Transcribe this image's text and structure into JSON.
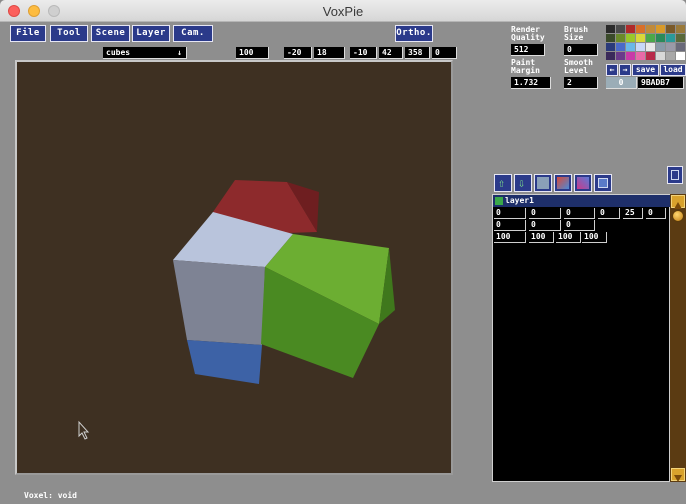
{
  "window": {
    "title": "VoxPie"
  },
  "menu": {
    "file": "File",
    "tool": "Tool",
    "scene": "Scene",
    "layer": "Layer",
    "cam": "Cam.",
    "ortho": "Ortho."
  },
  "toolbar": {
    "shape_select": "cubes",
    "shape_arrow": "↓",
    "fields": [
      "100",
      "-20",
      "18",
      "-10",
      "42",
      "358",
      "0"
    ]
  },
  "settings": {
    "render_quality_label": "Render\nQuality",
    "render_quality_value": "512",
    "brush_size_label": "Brush\nSize",
    "brush_size_value": "0",
    "paint_margin_label": "Paint\nMargin",
    "paint_margin_value": "1.732",
    "smooth_level_label": "Smooth\nLevel",
    "smooth_level_value": "2",
    "prev_arrow": "←",
    "next_arrow": "→",
    "save_label": "save",
    "load_label": "load",
    "color_index": "0",
    "color_hex": "9BADB7"
  },
  "palette": {
    "colors": [
      "#2a2a2a",
      "#4a4a4a",
      "#b02a2a",
      "#d8702a",
      "#c08a3a",
      "#d89a2a",
      "#7a5a2a",
      "#9a7a3a",
      "#3a4a2a",
      "#6a8a2a",
      "#9ac82a",
      "#d8d83a",
      "#4aa84a",
      "#2a8a5a",
      "#2a9a9a",
      "#5a6a3a",
      "#2a3a7a",
      "#4a6ac8",
      "#6ab8e8",
      "#c8d8f8",
      "#e8e8e8",
      "#8a9aa8",
      "#9a9aa8",
      "#6a6a7a",
      "#3a2a5a",
      "#6a3a8a",
      "#c83aa8",
      "#e86aa8",
      "#b82a4a",
      "#d8d8d8",
      "#a8a8a8",
      "#ffffff"
    ]
  },
  "layers": {
    "rows": [
      {
        "name": "layer1"
      }
    ],
    "transform_row1": [
      "0",
      "0",
      "0",
      "0",
      "25",
      "0"
    ],
    "transform_row2": [
      "0",
      "0",
      "0"
    ],
    "transform_row3": [
      "100",
      "100",
      "100",
      "100"
    ]
  },
  "status": {
    "text": "Voxel: void"
  }
}
